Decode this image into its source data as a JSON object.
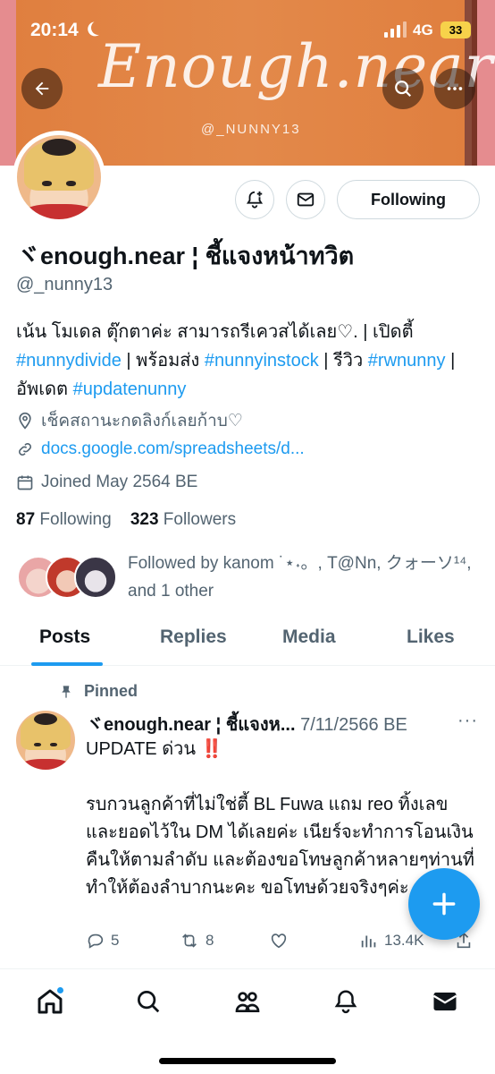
{
  "status_bar": {
    "time": "20:14",
    "network": "4G",
    "battery": "33"
  },
  "banner": {
    "title": "Enough.near",
    "handle": "@_NUNNY13"
  },
  "profile": {
    "display_name": "ヾenough.near ¦ ชี้แจงหน้าทวิต",
    "handle": "@_nunny13",
    "follow_button": "Following",
    "bio": {
      "t1": "เน้น โมเดล ตุ๊กตาค่ะ สามารถรีเควสได้เลย♡. | เปิดตี้ ",
      "l1": "#nunnydivide",
      "t2": " | พร้อมส่ง ",
      "l2": "#nunnyinstock",
      "t3": " | รีวิว ",
      "l3": "#rwnunny",
      "t4": " | อัพเดต ",
      "l4": "#updatenunny"
    },
    "location": "เช็คสถานะกดลิงก์เลยก้าบ♡",
    "website": "docs.google.com/spreadsheets/d...",
    "joined": "Joined May 2564 BE",
    "following_count": "87",
    "following_label": "Following",
    "followers_count": "323",
    "followers_label": "Followers",
    "followed_by": "Followed by kanom ˙⋆˖。, T@Nn, クォーソ¹⁴, and 1 other"
  },
  "tabs": [
    "Posts",
    "Replies",
    "Media",
    "Likes"
  ],
  "tweet": {
    "pinned_label": "Pinned",
    "author": "ヾenough.near ¦ ชี้แจงห...",
    "date": "7/11/2566 BE",
    "body": "UPDATE ด่วน ‼️\n\nรบกวนลูกค้าที่ไม่ใช่ตี้ BL Fuwa แถม reo ทิ้งเลขและยอดไว้ใน DM ได้เลยค่ะ เนียร์จะทำการโอนเงินคืนให้ตามลำดับ และต้องขอโทษลูกค้าหลายๆท่านที่ทำให้ต้องลำบากนะคะ ขอโทษด้วยจริงๆค่ะ 🙏🏻",
    "replies": "5",
    "retweets": "8",
    "views": "13.4K"
  },
  "colors": {
    "accent": "#1d9bf0",
    "banner": "#e3894a",
    "text": "#0f1419",
    "secondary": "#536471"
  },
  "icons": [
    "back-arrow-icon",
    "search-icon",
    "more-icon",
    "bell-plus-icon",
    "mail-icon",
    "location-icon",
    "link-icon",
    "calendar-icon",
    "pin-icon",
    "reply-icon",
    "retweet-icon",
    "like-icon",
    "views-icon",
    "share-icon",
    "plus-icon",
    "home-icon",
    "explore-icon",
    "communities-icon",
    "notifications-icon",
    "messages-icon"
  ]
}
